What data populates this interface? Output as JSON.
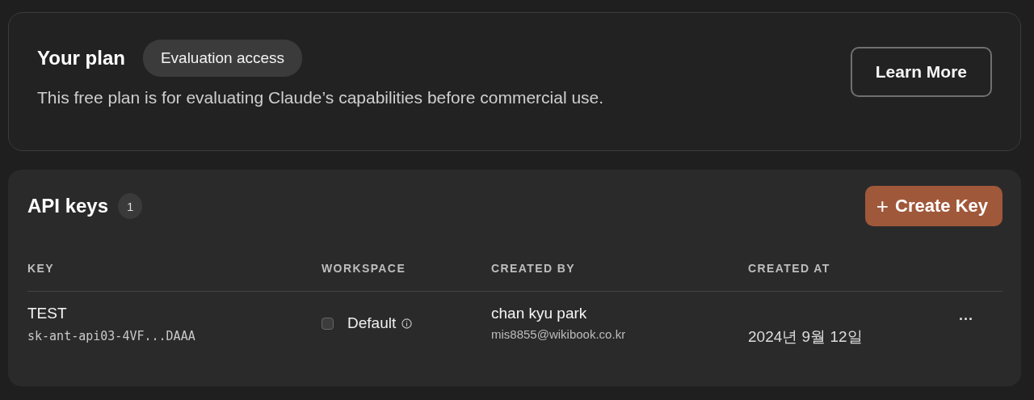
{
  "plan": {
    "title": "Your plan",
    "badge": "Evaluation access",
    "description": "This free plan is for evaluating Claude’s capabilities before commercial use.",
    "button": "Learn More"
  },
  "api_keys": {
    "title": "API keys",
    "count": "1",
    "create_button": {
      "icon": "+",
      "label": "Create Key"
    },
    "table": {
      "columns": [
        "KEY",
        "WORKSPACE",
        "CREATED BY",
        "CREATED AT"
      ],
      "rows": [
        {
          "name": "TEST",
          "key": "sk-ant-api03-4VF...DAAA",
          "workspace": "Default",
          "created_by_name": "chan kyu park",
          "created_by_email": "mis8855@wikibook.co.kr",
          "created_at": "2024년 9월 12일",
          "menu": "···"
        }
      ]
    }
  }
}
